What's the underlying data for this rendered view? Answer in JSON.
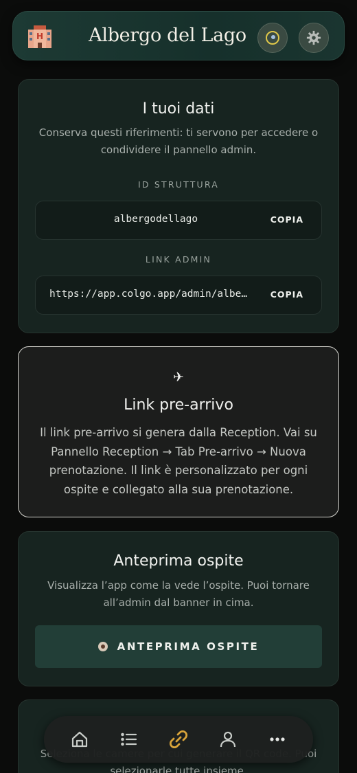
{
  "header": {
    "title": "Albergo del Lago",
    "logo_icon": "hotel-icon",
    "theme_icon": "theme-toggle-icon",
    "settings_icon": "gear-icon"
  },
  "data_card": {
    "title": "I tuoi dati",
    "description": "Conserva questi riferimenti: ti servono per accedere o condividere il pannello admin.",
    "id_label": "ID STRUTTURA",
    "id_value": "albergodellago",
    "id_copy": "COPIA",
    "link_label": "LINK ADMIN",
    "link_value": "https://app.colgo.app/admin/albergodellago",
    "link_copy": "COPIA"
  },
  "prearrival_card": {
    "icon": "airplane-icon",
    "glyph": "✈",
    "title": "Link pre-arrivo",
    "description": "Il link pre-arrivo si genera dalla Reception. Vai su Pannello Reception → Tab Pre-arrivo → Nuova prenotazione. Il link è personalizzato per ogni ospite e collegato alla sua prenotazione."
  },
  "preview_card": {
    "title": "Anteprima ospite",
    "description": "Visualizza l’app come la vede l’ospite. Puoi tornare all’admin dal banner in cima.",
    "button_label": "ANTEPRIMA OSPITE",
    "button_icon": "eye-icon"
  },
  "qr_card": {
    "description": "Seleziona le camere per cui generare il QR code. Puoi selezionarle tutte insieme."
  },
  "bottom_nav": {
    "items": [
      "home-icon",
      "list-icon",
      "link-icon",
      "user-icon",
      "more-icon"
    ],
    "active": "link-icon",
    "active_color": "#d9a43a"
  }
}
